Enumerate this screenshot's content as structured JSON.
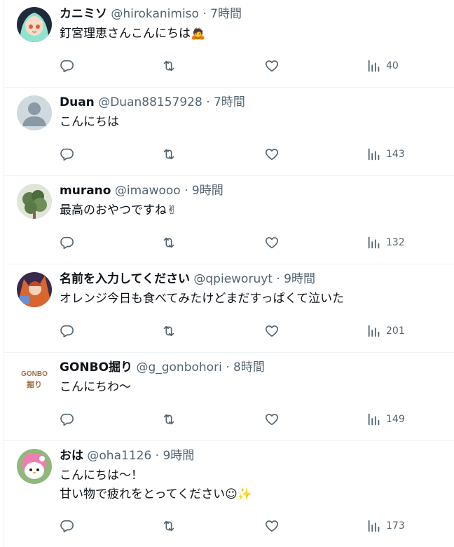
{
  "colors": {
    "text": "#0f1419",
    "muted": "#536471",
    "border": "#eff3f4"
  },
  "tweets": [
    {
      "name": "カニミソ",
      "handle": "@hirokanimiso",
      "sep": "·",
      "time": "7時間",
      "lines": [
        "釘宮理恵さんこんにちは🙇"
      ],
      "views": "40"
    },
    {
      "name": "Duan",
      "handle": "@Duan88157928",
      "sep": "·",
      "time": "7時間",
      "lines": [
        "こんにちは"
      ],
      "views": "143"
    },
    {
      "name": "murano",
      "handle": "@imawooo",
      "sep": "·",
      "time": "9時間",
      "lines": [
        "最高のおやつですね✌"
      ],
      "views": "132"
    },
    {
      "name": "名前を入力してください",
      "handle": "@qpieworuyt",
      "sep": "·",
      "time": "9時間",
      "lines": [
        "オレンジ今日も食べてみたけどまだすっぱくて泣いた"
      ],
      "views": "201"
    },
    {
      "name": "GONBO掘り",
      "handle": "@g_gonbohori",
      "sep": "·",
      "time": "8時間",
      "lines": [
        "こんにちわ〜"
      ],
      "views": "149",
      "avatar_text": [
        "GONBO",
        "掘り"
      ]
    },
    {
      "name": "おは",
      "handle": "@oha1126",
      "sep": "·",
      "time": "9時間",
      "lines": [
        "こんにちは〜！",
        "甘い物で疲れをとってください☺✨"
      ],
      "views": "173"
    }
  ]
}
